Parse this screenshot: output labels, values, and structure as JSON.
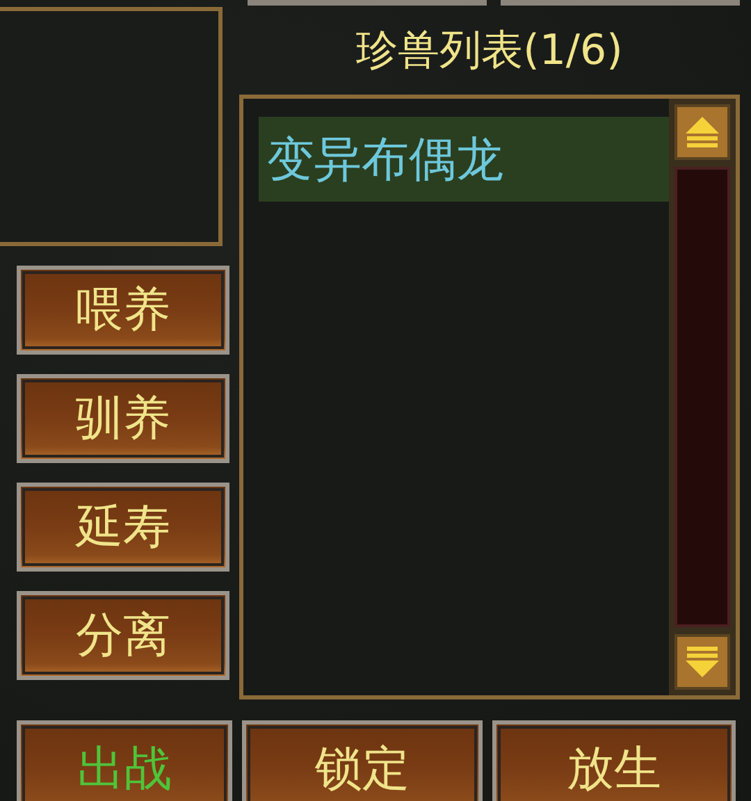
{
  "side_buttons": [
    {
      "label": "喂养"
    },
    {
      "label": "驯养"
    },
    {
      "label": "延寿"
    },
    {
      "label": "分离"
    }
  ],
  "list": {
    "title": "珍兽列表(1/6)",
    "items": [
      {
        "name": "变异布偶龙",
        "selected": true
      }
    ]
  },
  "bottom_buttons": [
    {
      "label": "出战",
      "highlighted": true
    },
    {
      "label": "锁定",
      "highlighted": false
    },
    {
      "label": "放生",
      "highlighted": false
    }
  ]
}
